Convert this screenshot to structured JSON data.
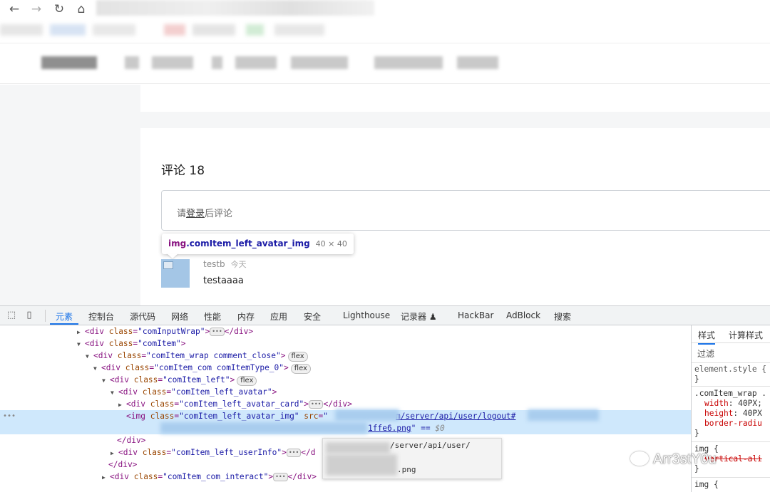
{
  "browser": {
    "back_icon": "arrow-left-icon",
    "forward_icon": "arrow-right-icon",
    "reload_icon": "reload-icon",
    "home_icon": "home-icon"
  },
  "page": {
    "comments_label": "评论 18",
    "comment_input": {
      "prefix": "请",
      "login_link": "登录",
      "suffix": "后评论"
    },
    "tooltip": {
      "tag": "img",
      "class_name": ".comItem_left_avatar_img",
      "dims": "40 × 40"
    },
    "comment": {
      "user": "testb",
      "time": "今天",
      "text": "testaaaa"
    }
  },
  "devtools": {
    "tabs": [
      "元素",
      "控制台",
      "源代码",
      "网络",
      "性能",
      "内存",
      "应用",
      "安全",
      "Lighthouse",
      "记录器 ♟",
      "HackBar",
      "AdBlock",
      "搜索"
    ],
    "active_tab": "元素",
    "elements": {
      "l1_tag": "div",
      "l1_attr": "class",
      "l1_val": "\"comInputWrap\"",
      "l1_close": "</div>",
      "l2_tag": "div",
      "l2_attr": "class",
      "l2_val": "\"comItem\"",
      "l3_tag": "div",
      "l3_attr": "class",
      "l3_val": "\"comItem_wrap  comment_close\"",
      "l3_badge": "flex",
      "l4_tag": "div",
      "l4_attr": "class",
      "l4_val": "\"comItem_com comItemType_0\"",
      "l4_badge": "flex",
      "l5_tag": "div",
      "l5_attr": "class",
      "l5_val": "\"comItem_left\"",
      "l5_badge": "flex",
      "l6_tag": "div",
      "l6_attr": "class",
      "l6_val": "\"comItem_left_avatar\"",
      "l7_tag": "div",
      "l7_attr": "class",
      "l7_val": "\"comItem_left_avatar_card\"",
      "l7_close": "</div>",
      "l8_tag": "img",
      "l8_attr1": "class",
      "l8_val1": "\"comItem_left_avatar_img\"",
      "l8_attr2": "src",
      "l8_val2": "\"",
      "l8_link": "m/server/api/user/logout#",
      "l8b_link": "1ffe6.png",
      "l8b_tail": "\" == ",
      "l8b_dollar": "$0",
      "l9_close": "</div>",
      "l10_tag": "div",
      "l10_attr": "class",
      "l10_val": "\"comItem_left_userInfo\"",
      "l10_close": "</d",
      "l11_close": "</div>",
      "l12_tag": "div",
      "l12_attr": "class",
      "l12_val": "\"comItem_com_interact\"",
      "l12_close": "</div>",
      "popup_line1": "/server/api/user/",
      "popup_line2": ".png"
    },
    "styles": {
      "tabs": [
        "样式",
        "计算样式"
      ],
      "filter": "过滤",
      "element_style": "element.style {",
      "element_style_close": "}",
      "rule1_selector": ".comItem_wrap .",
      "rule1_p1": "width",
      "rule1_v1": "40PX;",
      "rule1_p2": "height",
      "rule1_v2": "40PX",
      "rule1_p3": "border-radiu",
      "rule1_close": "}",
      "rule2_selector": "img {",
      "rule2_p1": "vertical-ali",
      "rule2_close": "}",
      "rule3_selector": "img {"
    }
  },
  "watermark": "Arr3stY0u",
  "colors": {
    "tag": "#881280",
    "attr": "#994500",
    "value": "#1a1aa6",
    "selected_row": "#cfe8fc",
    "accent": "#1a73e8"
  }
}
